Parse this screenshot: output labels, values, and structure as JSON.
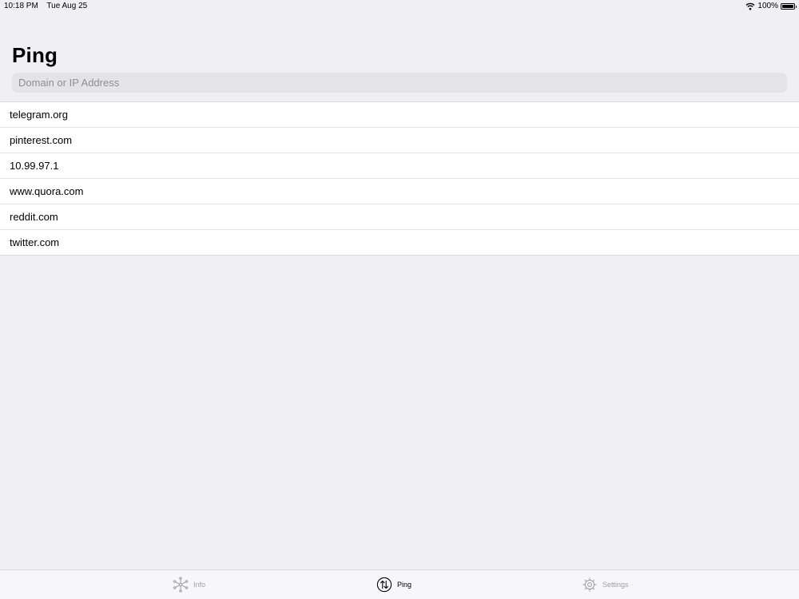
{
  "status_bar": {
    "time": "10:18 PM",
    "date": "Tue Aug 25",
    "battery": "100%"
  },
  "page": {
    "title": "Ping"
  },
  "search": {
    "placeholder": "Domain or IP Address",
    "value": ""
  },
  "hosts": [
    {
      "name": "telegram.org"
    },
    {
      "name": "pinterest.com"
    },
    {
      "name": "10.99.97.1"
    },
    {
      "name": "www.quora.com"
    },
    {
      "name": "reddit.com"
    },
    {
      "name": "twitter.com"
    }
  ],
  "tabs": [
    {
      "label": "Info",
      "icon": "network-icon",
      "active": false
    },
    {
      "label": "Ping",
      "icon": "ping-arrows-icon",
      "active": true
    },
    {
      "label": "Settings",
      "icon": "gear-icon",
      "active": false
    }
  ]
}
